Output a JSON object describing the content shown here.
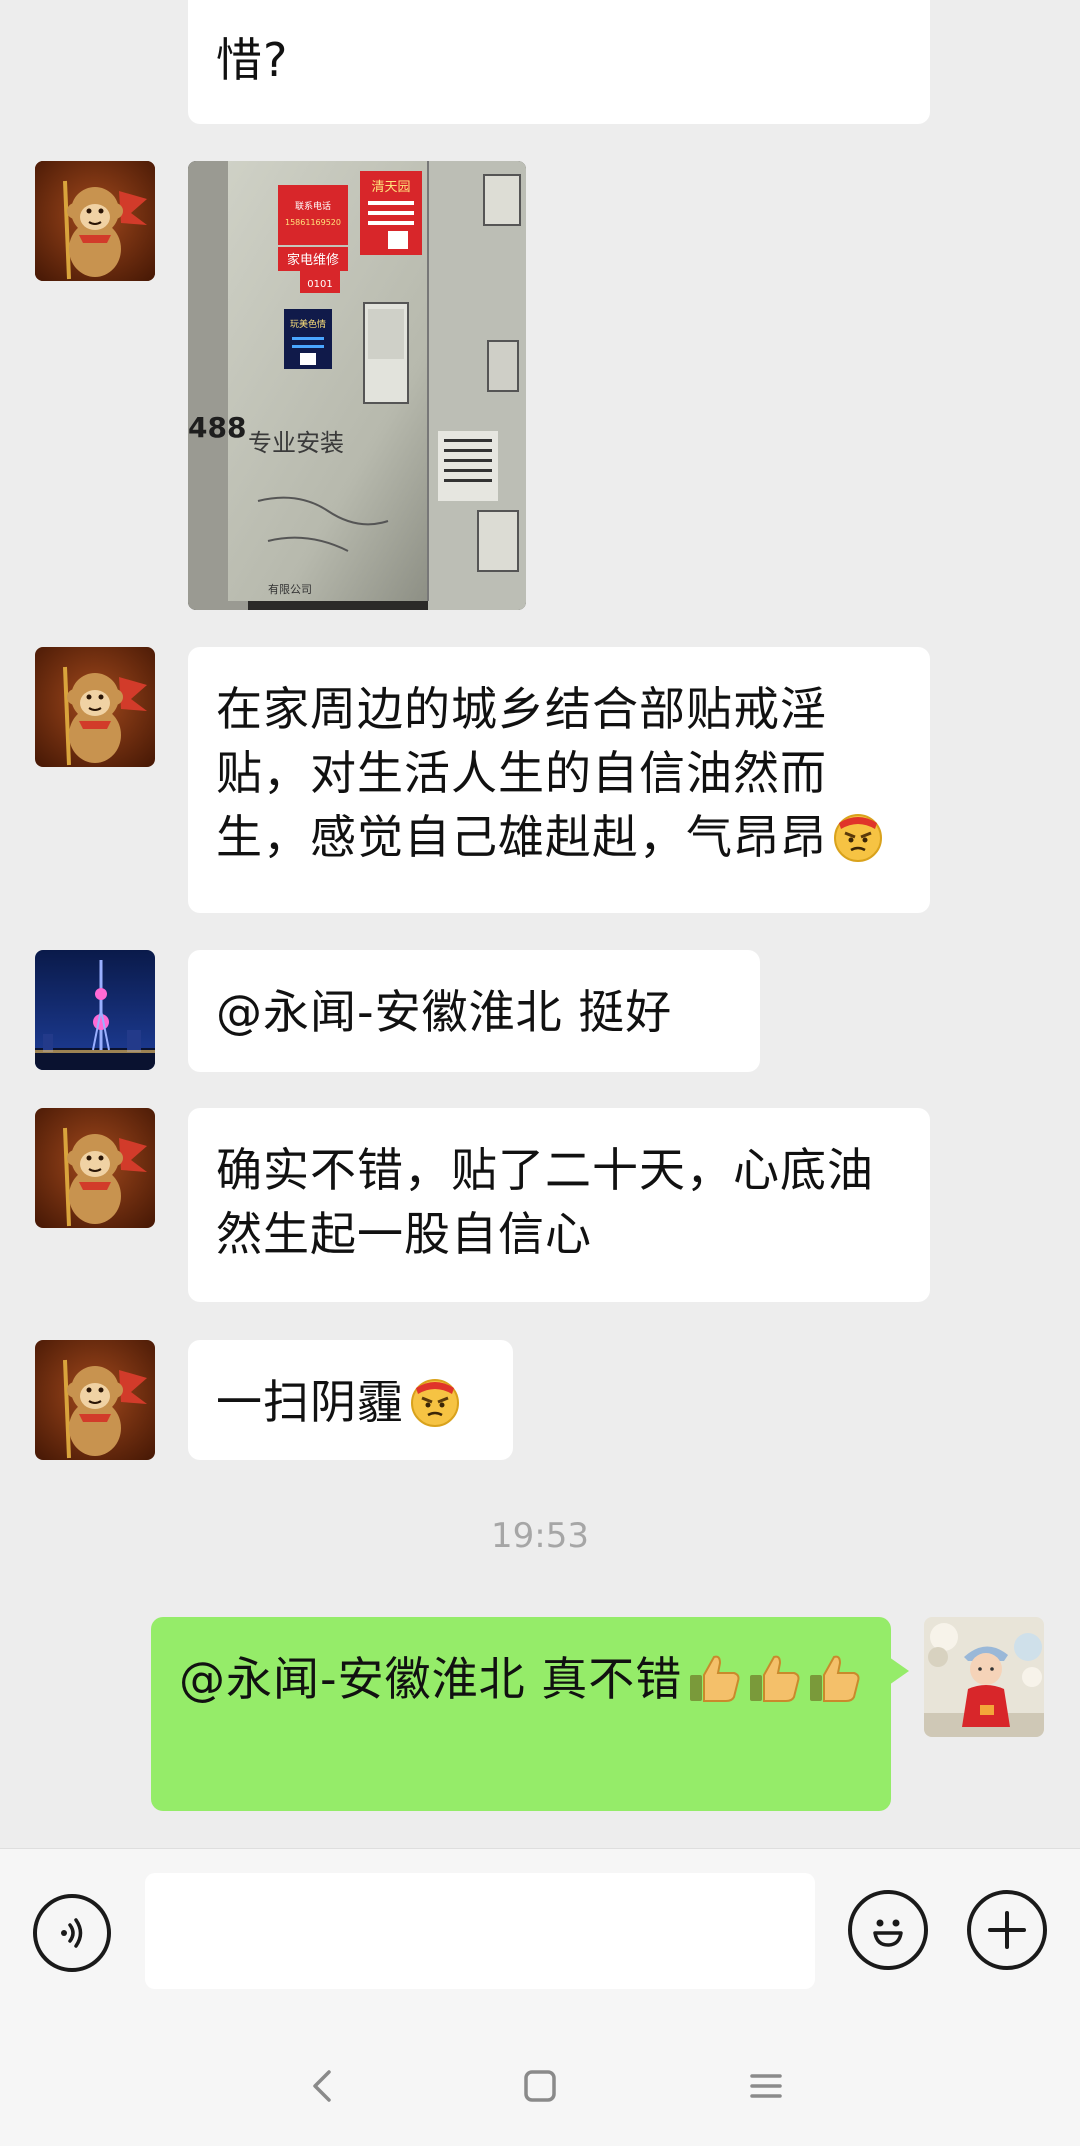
{
  "messages": {
    "partial_text": "惜?",
    "m1_text": "在家周边的城乡结合部贴戒淫贴，对生活人生的自信油然而生，感觉自己雄赳赳，气昂昂",
    "m2_text": "@永闻-安徽淮北  挺好",
    "m3_text": "确实不错，贴了二十天，心底油然生起一股自信心",
    "m4_text": "一扫阴霾",
    "timestamp": "19:53",
    "m5_text": "@永闻-安徽淮北  真不错"
  },
  "photo": {
    "sign_top_right": "清天园",
    "sign_appliance": "家电维修",
    "sign_small": "0101",
    "sign_blue": "玩美色情",
    "graffiti_488": "488",
    "graffiti_writing": "专业安装",
    "graffiti_company": "有限公司"
  },
  "input": {
    "value": "",
    "placeholder": ""
  },
  "icons": {
    "voice": "voice-icon",
    "emoji": "emoji-icon",
    "plus": "plus-icon",
    "back": "back-icon",
    "home": "home-icon",
    "menu": "menu-icon",
    "angry_emoji": "angry-face-emoji",
    "thumbs_up": "thumbs-up-emoji"
  },
  "colors": {
    "background": "#ededed",
    "bubble_in": "#ffffff",
    "bubble_out": "#95ec69",
    "timestamp": "#a6a6a6"
  }
}
